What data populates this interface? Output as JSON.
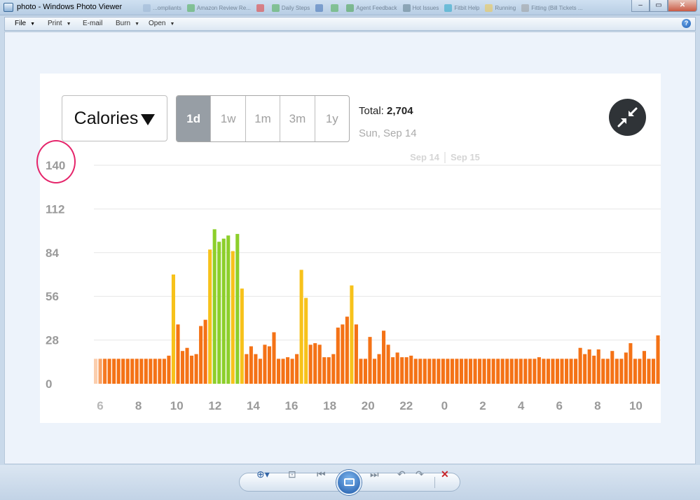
{
  "window": {
    "title": "photo - Windows Photo Viewer",
    "task_chips": [
      {
        "label": "...ompliants",
        "color": "#9cb6d4"
      },
      {
        "label": "Amazon Review Re...",
        "color": "#4caf50"
      },
      {
        "label": "",
        "color": "#e53935"
      },
      {
        "label": "Daily Steps",
        "color": "#4caf50"
      },
      {
        "label": "",
        "color": "#3f6fb5"
      },
      {
        "label": "",
        "color": "#4caf50"
      },
      {
        "label": "Agent Feedback",
        "color": "#43a047"
      },
      {
        "label": "Hot Issues",
        "color": "#607d8b"
      },
      {
        "label": "Fitbit Help",
        "color": "#26a7c9"
      },
      {
        "label": "Running",
        "color": "#f2c94c"
      },
      {
        "label": "Fitting (Bill Tickets ...",
        "color": "#9e9e9e"
      }
    ],
    "minimize": "‒",
    "maximize": "▭",
    "close": "✕"
  },
  "menu": {
    "file": "File",
    "print": "Print",
    "email": "E-mail",
    "burn": "Burn",
    "open": "Open",
    "help": "?"
  },
  "dashboard": {
    "metric": "Calories",
    "ranges": [
      "1d",
      "1w",
      "1m",
      "3m",
      "1y"
    ],
    "active_range": "1d",
    "total_label": "Total:",
    "total_value": "2,704",
    "date": "Sun, Sep 14"
  },
  "chart_data": {
    "type": "bar",
    "ylim": [
      0,
      140
    ],
    "yticks": [
      0,
      28,
      56,
      84,
      112,
      140
    ],
    "xtick_labels": [
      "6",
      "8",
      "10",
      "12",
      "14",
      "16",
      "18",
      "20",
      "22",
      "0",
      "2",
      "4",
      "6",
      "8",
      "10"
    ],
    "day_markers": [
      "Sep 14",
      "Sep 15"
    ],
    "colors": {
      "low": "#f47216",
      "mid": "#f7c21b",
      "high": "#8dcf2b"
    },
    "values": [
      16,
      16,
      16,
      16,
      16,
      16,
      16,
      16,
      16,
      16,
      16,
      16,
      16,
      16,
      16,
      16,
      18,
      70,
      38,
      21,
      23,
      18,
      19,
      37,
      41,
      86,
      99,
      91,
      93,
      95,
      85,
      96,
      61,
      19,
      24,
      19,
      16,
      25,
      24,
      33,
      16,
      16,
      17,
      16,
      19,
      73,
      55,
      25,
      26,
      25,
      17,
      17,
      19,
      36,
      38,
      43,
      63,
      38,
      16,
      16,
      30,
      16,
      19,
      34,
      25,
      17,
      20,
      17,
      17,
      18,
      16,
      16,
      16,
      16,
      16,
      16,
      16,
      16,
      16,
      16,
      16,
      16,
      16,
      16,
      16,
      16,
      16,
      16,
      16,
      16,
      16,
      16,
      16,
      16,
      16,
      16,
      16,
      17,
      16,
      16,
      16,
      16,
      16,
      16,
      16,
      16,
      23,
      19,
      22,
      18,
      22,
      16,
      16,
      21,
      16,
      16,
      20,
      26,
      16,
      16,
      21,
      16,
      16,
      31
    ]
  },
  "bottom_bar": {
    "zoom": "⊕▾",
    "fit": "⊡",
    "prev": "⏮",
    "next": "⏭",
    "rotate_ccw": "↶",
    "rotate_cw": "↷",
    "delete": "✕"
  }
}
